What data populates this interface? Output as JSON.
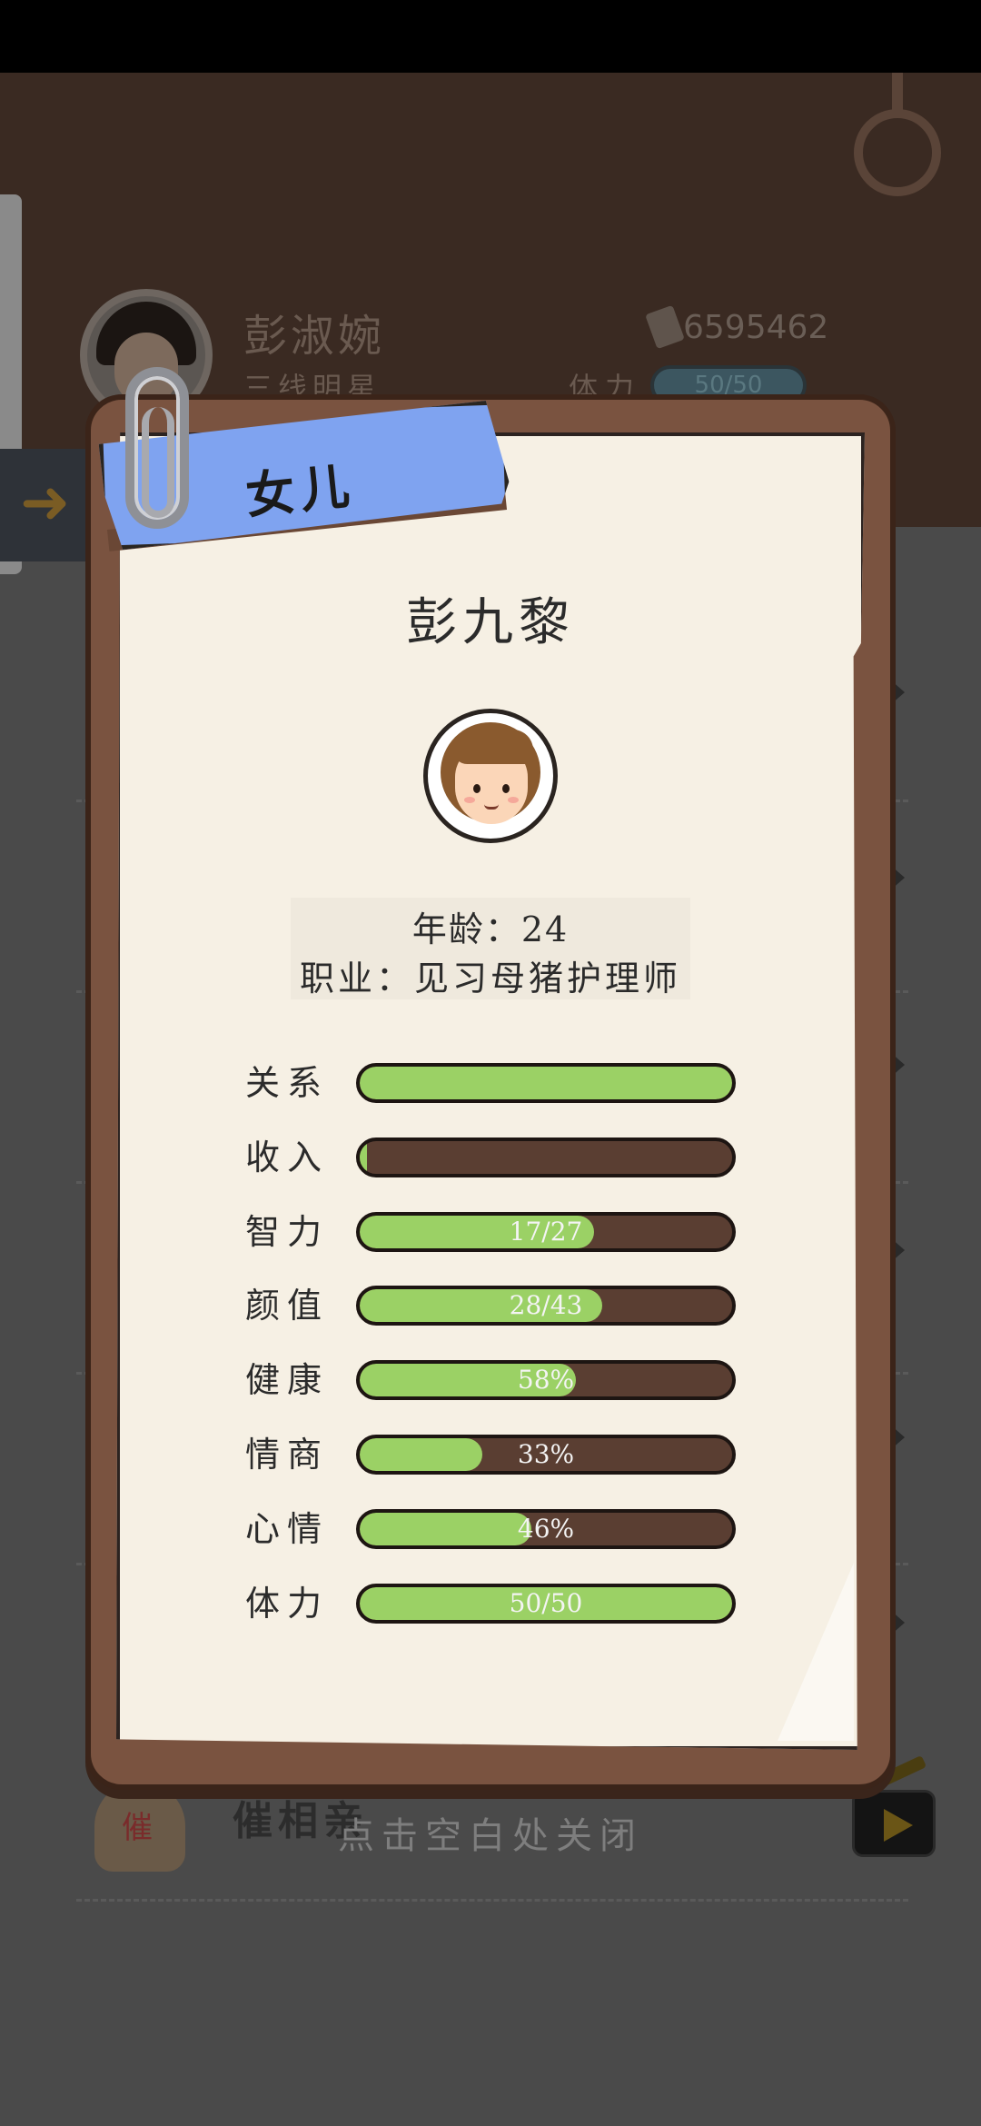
{
  "parent": {
    "name": "彭淑婉",
    "title": "三线明星",
    "money": "6595462",
    "stamina_label": "体力",
    "stamina_value": "50/50"
  },
  "background_list": {
    "bottom_item_name": "催相亲",
    "bottom_badge_char": "催"
  },
  "modal": {
    "tag_label": "女儿",
    "child_name": "彭九黎",
    "age_line": "年龄：24",
    "job_line": "职业：见习母猪护理师",
    "stats": [
      {
        "label": "关系",
        "text": "",
        "fill": 1.0
      },
      {
        "label": "收入",
        "text": "",
        "fill": 0.02
      },
      {
        "label": "智力",
        "text": "17/27",
        "fill": 0.63
      },
      {
        "label": "颜值",
        "text": "28/43",
        "fill": 0.65
      },
      {
        "label": "健康",
        "text": "58%",
        "fill": 0.58
      },
      {
        "label": "情商",
        "text": "33%",
        "fill": 0.33
      },
      {
        "label": "心情",
        "text": "46%",
        "fill": 0.46
      },
      {
        "label": "体力",
        "text": "50/50",
        "fill": 1.0
      }
    ]
  },
  "close_hint": "点击空白处关闭",
  "colors": {
    "bar_fill": "#9bd165",
    "bar_track": "#5a3e32",
    "tag": "#7fa3f0",
    "board": "#7a5340",
    "paper": "#f6f0e4"
  }
}
